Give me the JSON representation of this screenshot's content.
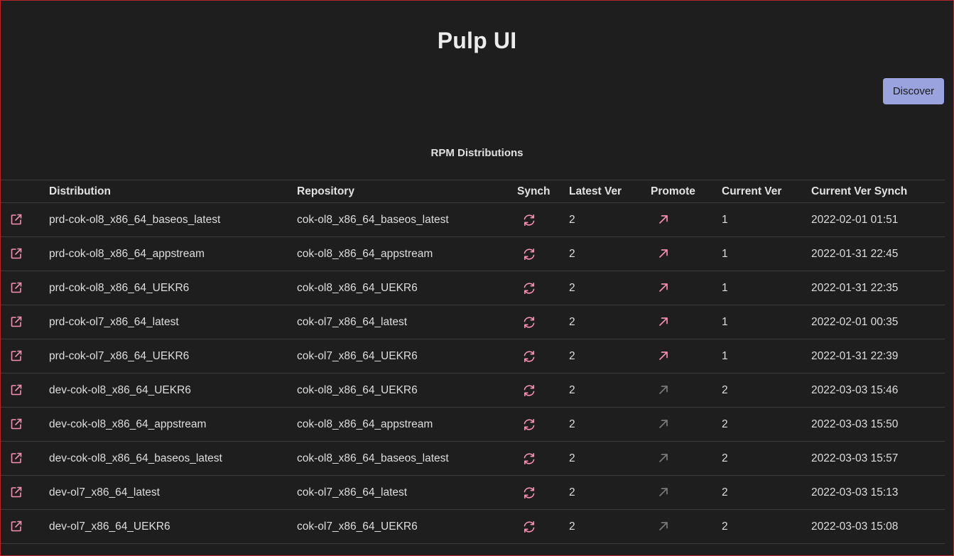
{
  "app": {
    "title": "Pulp UI",
    "discover_label": "Discover"
  },
  "table": {
    "caption": "RPM Distributions",
    "headers": {
      "distribution": "Distribution",
      "repository": "Repository",
      "synch": "Synch",
      "latest_ver": "Latest Ver",
      "promote": "Promote",
      "current_ver": "Current Ver",
      "current_ver_synch": "Current Ver Synch"
    },
    "rows": [
      {
        "distribution": "prd-cok-ol8_x86_64_baseos_latest",
        "repository": "cok-ol8_x86_64_baseos_latest",
        "latest_ver": "2",
        "current_ver": "1",
        "current_ver_synch": "2022-02-01 01:51",
        "promote_enabled": true
      },
      {
        "distribution": "prd-cok-ol8_x86_64_appstream",
        "repository": "cok-ol8_x86_64_appstream",
        "latest_ver": "2",
        "current_ver": "1",
        "current_ver_synch": "2022-01-31 22:45",
        "promote_enabled": true
      },
      {
        "distribution": "prd-cok-ol8_x86_64_UEKR6",
        "repository": "cok-ol8_x86_64_UEKR6",
        "latest_ver": "2",
        "current_ver": "1",
        "current_ver_synch": "2022-01-31 22:35",
        "promote_enabled": true
      },
      {
        "distribution": "prd-cok-ol7_x86_64_latest",
        "repository": "cok-ol7_x86_64_latest",
        "latest_ver": "2",
        "current_ver": "1",
        "current_ver_synch": "2022-02-01 00:35",
        "promote_enabled": true
      },
      {
        "distribution": "prd-cok-ol7_x86_64_UEKR6",
        "repository": "cok-ol7_x86_64_UEKR6",
        "latest_ver": "2",
        "current_ver": "1",
        "current_ver_synch": "2022-01-31 22:39",
        "promote_enabled": true
      },
      {
        "distribution": "dev-cok-ol8_x86_64_UEKR6",
        "repository": "cok-ol8_x86_64_UEKR6",
        "latest_ver": "2",
        "current_ver": "2",
        "current_ver_synch": "2022-03-03 15:46",
        "promote_enabled": false
      },
      {
        "distribution": "dev-cok-ol8_x86_64_appstream",
        "repository": "cok-ol8_x86_64_appstream",
        "latest_ver": "2",
        "current_ver": "2",
        "current_ver_synch": "2022-03-03 15:50",
        "promote_enabled": false
      },
      {
        "distribution": "dev-cok-ol8_x86_64_baseos_latest",
        "repository": "cok-ol8_x86_64_baseos_latest",
        "latest_ver": "2",
        "current_ver": "2",
        "current_ver_synch": "2022-03-03 15:57",
        "promote_enabled": false
      },
      {
        "distribution": "dev-ol7_x86_64_latest",
        "repository": "cok-ol7_x86_64_latest",
        "latest_ver": "2",
        "current_ver": "2",
        "current_ver_synch": "2022-03-03 15:13",
        "promote_enabled": false
      },
      {
        "distribution": "dev-ol7_x86_64_UEKR6",
        "repository": "cok-ol7_x86_64_UEKR6",
        "latest_ver": "2",
        "current_ver": "2",
        "current_ver_synch": "2022-03-03 15:08",
        "promote_enabled": false
      }
    ]
  },
  "icons": {
    "open_link": "external-link-icon",
    "synch": "sync-icon",
    "promote": "arrow-up-right-icon"
  },
  "colors": {
    "background": "#1e1e1e",
    "accent_pink": "#f48fb1",
    "disabled_gray": "#7a7a7a",
    "button_bg": "#9aa3de",
    "window_border": "#b3262c"
  }
}
